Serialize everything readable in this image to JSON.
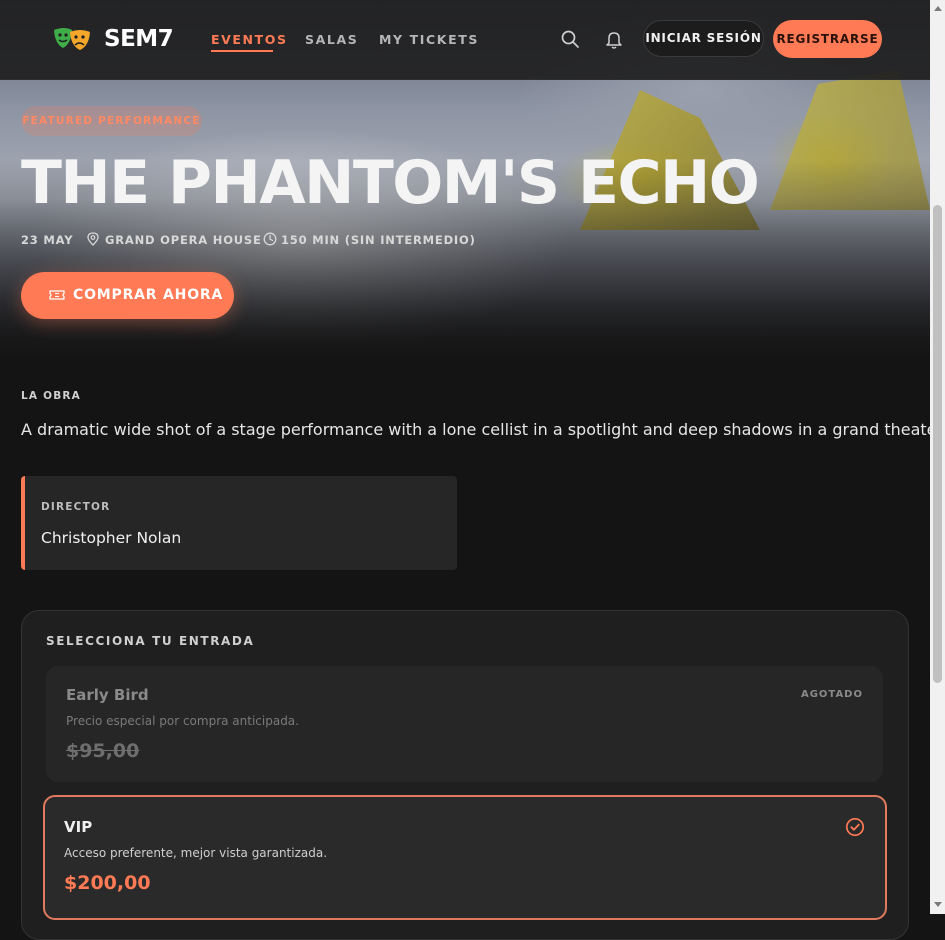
{
  "nav": {
    "brand": "SEM7",
    "links": [
      "EVENTOS",
      "SALAS",
      "MY TICKETS"
    ],
    "active_link": "EVENTOS",
    "login_label": "INICIAR SESIÓN",
    "register_label": "REGISTRARSE",
    "icons": [
      "theater-masks-logo-icon",
      "search-icon",
      "bell-icon"
    ]
  },
  "hero": {
    "badge": "FEATURED PERFORMANCE",
    "title": "THE PHANTOM'S ECHO",
    "date": "23 MAY",
    "venue": "GRAND OPERA HOUSE",
    "duration": "150 MIN (SIN INTERMEDIO)",
    "buy_label": "COMPRAR AHORA"
  },
  "about": {
    "label": "LA OBRA",
    "synopsis": "A dramatic wide shot of a stage performance with a lone cellist in a spotlight and deep shadows in a grand theater."
  },
  "director": {
    "label": "DIRECTOR",
    "name": "Christopher Nolan"
  },
  "tickets": {
    "title": "SELECCIONA TU ENTRADA",
    "options": [
      {
        "name": "Early Bird",
        "description": "Precio especial por compra anticipada.",
        "price": "$95,00",
        "status": "AGOTADO",
        "selected": false
      },
      {
        "name": "VIP",
        "description": "Acceso preferente, mejor vista garantizada.",
        "price": "$200,00",
        "status": "",
        "selected": true
      }
    ]
  },
  "colors": {
    "accent": "#ff7a55",
    "background": "#141414",
    "card": "#262626"
  }
}
